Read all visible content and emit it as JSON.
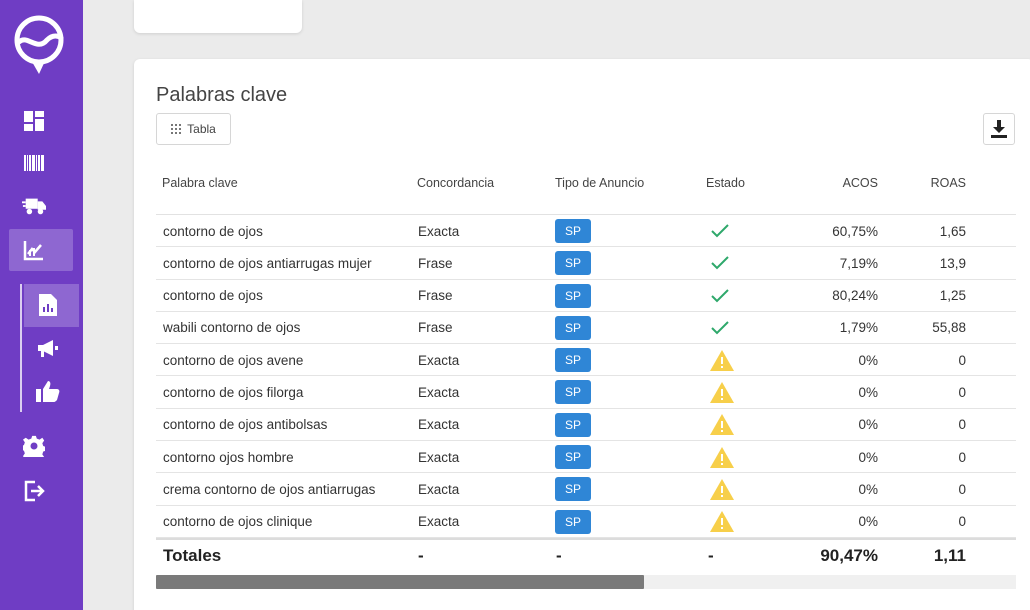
{
  "sidebar": {
    "icons": [
      "logo-icon",
      "dashboard-icon",
      "barcode-icon",
      "truck-icon",
      "analytics-icon",
      "report-icon",
      "megaphone-icon",
      "thumbs-up-icon",
      "gear-icon",
      "logout-icon"
    ]
  },
  "keywords": {
    "title": "Palabras clave",
    "view_label": "Tabla",
    "columns": {
      "keyword": "Palabra clave",
      "match": "Concordancia",
      "ad_type": "Tipo de Anuncio",
      "status": "Estado",
      "acos": "ACOS",
      "roas": "ROAS"
    },
    "rows": [
      {
        "keyword": "contorno de ojos",
        "match": "Exacta",
        "ad_type": "SP",
        "status": "ok",
        "acos": "60,75%",
        "roas": "1,65"
      },
      {
        "keyword": "contorno de ojos antiarrugas mujer",
        "match": "Frase",
        "ad_type": "SP",
        "status": "ok",
        "acos": "7,19%",
        "roas": "13,9"
      },
      {
        "keyword": "contorno de ojos",
        "match": "Frase",
        "ad_type": "SP",
        "status": "ok",
        "acos": "80,24%",
        "roas": "1,25"
      },
      {
        "keyword": "wabili contorno de ojos",
        "match": "Frase",
        "ad_type": "SP",
        "status": "ok",
        "acos": "1,79%",
        "roas": "55,88"
      },
      {
        "keyword": "contorno de ojos avene",
        "match": "Exacta",
        "ad_type": "SP",
        "status": "warning",
        "acos": "0%",
        "roas": "0"
      },
      {
        "keyword": "contorno de ojos filorga",
        "match": "Exacta",
        "ad_type": "SP",
        "status": "warning",
        "acos": "0%",
        "roas": "0"
      },
      {
        "keyword": "contorno de ojos antibolsas",
        "match": "Exacta",
        "ad_type": "SP",
        "status": "warning",
        "acos": "0%",
        "roas": "0"
      },
      {
        "keyword": "contorno ojos hombre",
        "match": "Exacta",
        "ad_type": "SP",
        "status": "warning",
        "acos": "0%",
        "roas": "0"
      },
      {
        "keyword": "crema contorno de ojos antiarrugas",
        "match": "Exacta",
        "ad_type": "SP",
        "status": "warning",
        "acos": "0%",
        "roas": "0"
      },
      {
        "keyword": "contorno de ojos clinique",
        "match": "Exacta",
        "ad_type": "SP",
        "status": "warning",
        "acos": "0%",
        "roas": "0"
      }
    ],
    "totals": {
      "label": "Totales",
      "match": "-",
      "ad_type": "-",
      "status": "-",
      "acos": "90,47%",
      "roas": "1,11"
    }
  },
  "colors": {
    "sidebar": "#6f3dc4",
    "sp_badge": "#2f86d6",
    "check": "#2ea86b",
    "warning": "#f7cf4a"
  }
}
